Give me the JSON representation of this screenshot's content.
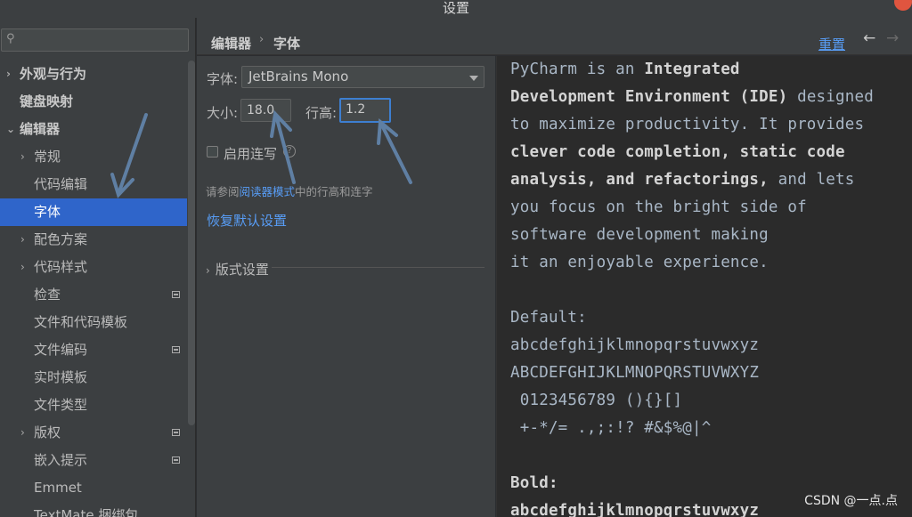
{
  "window": {
    "title": "设置"
  },
  "search": {
    "placeholder": ""
  },
  "sidebar": {
    "items": [
      {
        "label": "外观与行为",
        "arrow": "›"
      },
      {
        "label": "键盘映射",
        "arrow": ""
      },
      {
        "label": "编辑器",
        "arrow": "⌄"
      },
      {
        "label": "常规",
        "arrow": "›"
      },
      {
        "label": "代码编辑",
        "arrow": ""
      },
      {
        "label": "字体",
        "arrow": ""
      },
      {
        "label": "配色方案",
        "arrow": "›"
      },
      {
        "label": "代码样式",
        "arrow": "›"
      },
      {
        "label": "检查",
        "arrow": ""
      },
      {
        "label": "文件和代码模板",
        "arrow": ""
      },
      {
        "label": "文件编码",
        "arrow": ""
      },
      {
        "label": "实时模板",
        "arrow": ""
      },
      {
        "label": "文件类型",
        "arrow": ""
      },
      {
        "label": "版权",
        "arrow": "›"
      },
      {
        "label": "嵌入提示",
        "arrow": ""
      },
      {
        "label": "Emmet",
        "arrow": ""
      },
      {
        "label": "TextMate 捆绑包",
        "arrow": ""
      }
    ]
  },
  "header": {
    "breadcrumb_parent": "编辑器",
    "breadcrumb_sep": "›",
    "breadcrumb_current": "字体",
    "reset_label": "重置",
    "back_icon": "←",
    "forward_icon": "→"
  },
  "settings": {
    "font_label": "字体:",
    "font_value": "JetBrains Mono",
    "size_label": "大小:",
    "size_value": "18.0",
    "line_height_label": "行高:",
    "line_height_value": "1.2",
    "ligatures_label": "启用连写",
    "note_prefix": "请参阅",
    "note_link": "阅读器模式",
    "note_suffix": "中的行高和连字",
    "restore_label": "恢复默认设置",
    "typography_label": "版式设置"
  },
  "preview": {
    "lines": [
      [
        "PyCharm is an ",
        "Integrated"
      ],
      [
        "Development Environment (IDE)",
        " designed"
      ],
      [
        "to maximize productivity. It provides",
        ""
      ],
      [
        "clever code completion, static code",
        ""
      ],
      [
        "analysis, and refactorings,",
        " and lets"
      ],
      [
        "you focus on the bright side of",
        ""
      ],
      [
        "software development making",
        ""
      ],
      [
        "it an enjoyable experience.",
        ""
      ],
      [
        "",
        ""
      ],
      [
        "Default:",
        ""
      ],
      [
        "abcdefghijklmnopqrstuvwxyz",
        ""
      ],
      [
        "ABCDEFGHIJKLMNOPQRSTUVWXYZ",
        ""
      ],
      [
        " 0123456789 (){}[]",
        ""
      ],
      [
        " +-*/= .,;:!? #&$%@|^",
        ""
      ],
      [
        "",
        ""
      ],
      [
        "Bold:",
        ""
      ],
      [
        "abcdefghijklmnopqrstuvwxyz",
        ""
      ]
    ]
  },
  "watermark": "CSDN @一点.点",
  "colors": {
    "selection": "#2f65ca",
    "link": "#589df6",
    "annotation_arrow": "#5f7fa3"
  }
}
